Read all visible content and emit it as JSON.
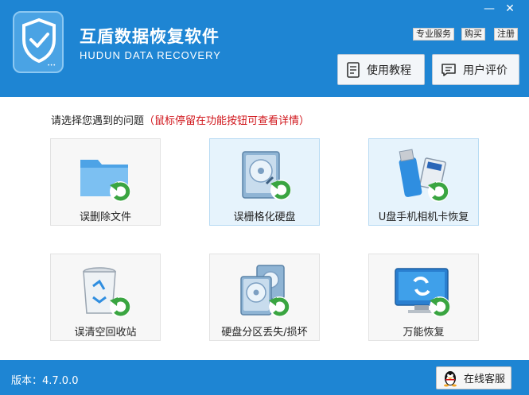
{
  "app": {
    "title": "互盾数据恢复软件",
    "subtitle": "HUDUN DATA RECOVERY"
  },
  "window_controls": {
    "minimize": "—",
    "close": "✕"
  },
  "top_links": {
    "service": "专业服务",
    "buy": "购买",
    "register": "注册"
  },
  "header_buttons": {
    "tutorial": "使用教程",
    "review": "用户评价"
  },
  "prompt": {
    "text": "请选择您遇到的问题",
    "hint": "（鼠标停留在功能按钮可查看详情）"
  },
  "options": [
    {
      "label": "误删除文件",
      "icon": "folder-restore-icon"
    },
    {
      "label": "误栅格化硬盘",
      "icon": "harddisk-restore-icon"
    },
    {
      "label": "U盘手机相机卡恢复",
      "icon": "usb-sdcard-restore-icon"
    },
    {
      "label": "误清空回收站",
      "icon": "recycle-bin-restore-icon"
    },
    {
      "label": "硬盘分区丢失/损坏",
      "icon": "partition-restore-icon"
    },
    {
      "label": "万能恢复",
      "icon": "monitor-restore-icon"
    }
  ],
  "footer": {
    "version": "版本：4.7.0.0",
    "support": "在线客服"
  },
  "colors": {
    "brand_blue": "#1e85d3",
    "hint_red": "#d0141a",
    "highlight_tile": "#e6f3fc"
  }
}
